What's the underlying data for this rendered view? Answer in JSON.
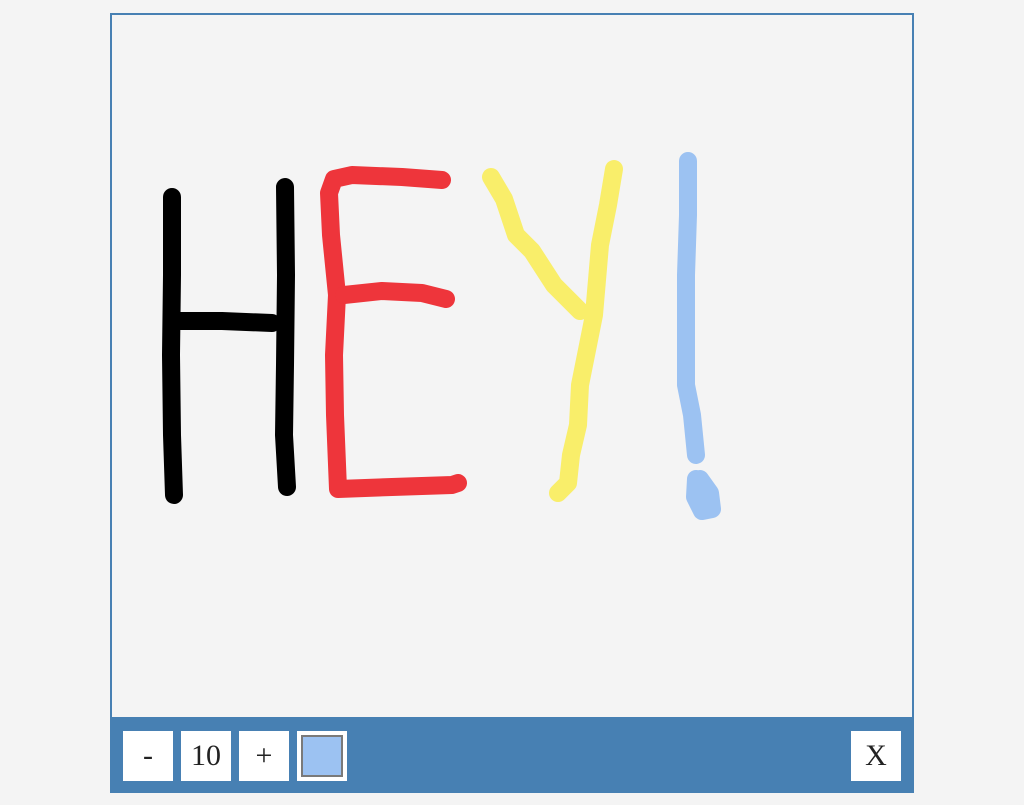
{
  "toolbar": {
    "decrease_label": "-",
    "size_value": "10",
    "increase_label": "+",
    "close_label": "X",
    "current_color": "#9cc2f2"
  },
  "colors": {
    "frame": "#4780b3",
    "canvas_bg": "#f4f4f4"
  }
}
